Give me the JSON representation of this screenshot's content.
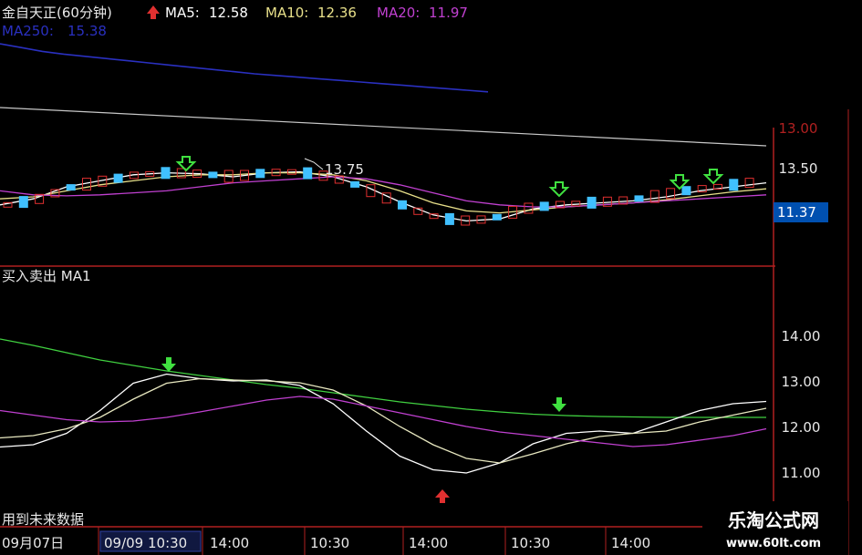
{
  "header": {
    "title": "金自天正(60分钟)",
    "ma5_label": "MA5:",
    "ma5_value": "12.58",
    "ma10_label": "MA10:",
    "ma10_value": "12.36",
    "ma20_label": "MA20:",
    "ma20_value": "11.97",
    "ma250_label": "MA250:",
    "ma250_value": "15.38"
  },
  "colors": {
    "ma5": "#ffffff",
    "ma10": "#e8e08a",
    "ma20": "#c040d0",
    "ma250": "#2a30c0",
    "green": "#40e040",
    "red": "#e03030",
    "cyan": "#40c0ff",
    "axis": "#b02020"
  },
  "price_annotation": "13.75",
  "current_price_badge": "11.37",
  "indicator_label": "买入卖出  MA1",
  "footer_note": "用到未来数据",
  "time_axis": [
    "09月07日",
    "09/09 10:30",
    "14:00",
    "10:30",
    "14:00",
    "10:30",
    "14:00"
  ],
  "watermark": {
    "title": "乐淘公式网",
    "url": "www.60lt.com"
  },
  "chart_data": [
    {
      "type": "line",
      "title": "金自天正(60分钟)",
      "y_ticks": [
        "13.50",
        "13.00"
      ],
      "x_categories": [
        "09月07日",
        "09/09 10:30",
        "14:00",
        "10:30",
        "14:00",
        "10:30",
        "14:00"
      ],
      "ylim": [
        12.85,
        14.3
      ],
      "series": [
        {
          "name": "MA5",
          "values": [
            13.12,
            13.18,
            13.3,
            13.36,
            13.42,
            13.44,
            13.43,
            13.4,
            13.44,
            13.45,
            13.4,
            13.3,
            13.15,
            13.02,
            12.96,
            12.98,
            13.08,
            13.12,
            13.14,
            13.16,
            13.2,
            13.26,
            13.3,
            13.34
          ]
        },
        {
          "name": "MA10",
          "values": [
            13.18,
            13.2,
            13.26,
            13.32,
            13.36,
            13.4,
            13.42,
            13.42,
            13.44,
            13.44,
            13.42,
            13.36,
            13.26,
            13.14,
            13.06,
            13.04,
            13.07,
            13.1,
            13.12,
            13.14,
            13.17,
            13.21,
            13.25,
            13.28
          ]
        },
        {
          "name": "MA20",
          "values": [
            13.26,
            13.22,
            13.21,
            13.22,
            13.24,
            13.26,
            13.3,
            13.34,
            13.36,
            13.38,
            13.4,
            13.38,
            13.32,
            13.24,
            13.16,
            13.12,
            13.1,
            13.1,
            13.12,
            13.14,
            13.16,
            13.18,
            13.2,
            13.22
          ]
        },
        {
          "name": "MA250",
          "values": [
            15.55,
            15.48,
            15.41,
            15.36,
            15.32,
            15.28,
            15.24,
            15.2,
            15.16,
            15.12,
            15.08,
            15.04,
            15.0,
            14.97,
            14.94,
            14.91,
            14.88,
            14.85,
            14.82,
            14.79,
            14.76,
            14.73,
            14.7,
            14.67
          ]
        }
      ],
      "annotations": [
        "13.75"
      ],
      "current_price": "11.37"
    },
    {
      "type": "line",
      "title": "买入卖出  MA1",
      "y_ticks": [
        "14.00",
        "13.00",
        "12.00",
        "11.00"
      ],
      "ylim": [
        10.6,
        14.6
      ],
      "series": [
        {
          "name": "MA1",
          "values": [
            13.92,
            13.78,
            13.62,
            13.46,
            13.34,
            13.22,
            13.12,
            13.02,
            12.92,
            12.84,
            12.74,
            12.64,
            12.54,
            12.46,
            12.38,
            12.32,
            12.27,
            12.24,
            12.22,
            12.21,
            12.2,
            12.2,
            12.2,
            12.2
          ]
        },
        {
          "values": [
            11.55,
            11.6,
            11.85,
            12.35,
            12.95,
            13.15,
            13.05,
            13.0,
            13.02,
            12.9,
            12.5,
            11.9,
            11.35,
            11.05,
            10.98,
            11.2,
            11.62,
            11.85,
            11.9,
            11.85,
            12.1,
            12.35,
            12.5,
            12.55
          ]
        },
        {
          "values": [
            11.75,
            11.8,
            11.95,
            12.2,
            12.6,
            12.95,
            13.05,
            13.02,
            13.0,
            12.96,
            12.8,
            12.45,
            12.0,
            11.6,
            11.3,
            11.2,
            11.4,
            11.62,
            11.78,
            11.85,
            11.9,
            12.1,
            12.25,
            12.4
          ]
        },
        {
          "values": [
            12.35,
            12.25,
            12.15,
            12.1,
            12.12,
            12.2,
            12.32,
            12.45,
            12.58,
            12.66,
            12.6,
            12.45,
            12.3,
            12.15,
            12.0,
            11.88,
            11.8,
            11.72,
            11.64,
            11.56,
            11.6,
            11.7,
            11.8,
            11.95
          ]
        }
      ]
    }
  ]
}
